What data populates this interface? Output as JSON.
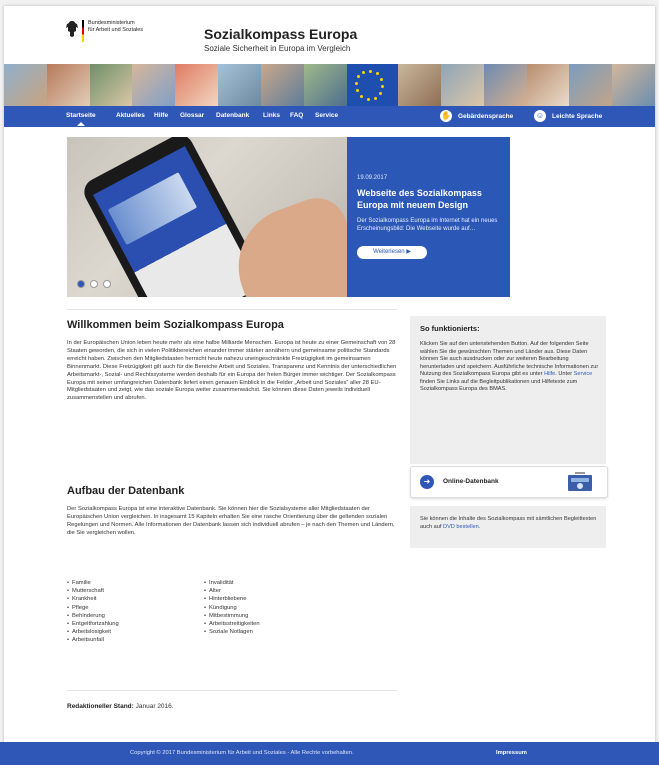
{
  "header": {
    "ministry": "Bundesministerium\nfür Arbeit und Soziales",
    "title": "Sozialkompass Europa",
    "subtitle": "Soziale Sicherheit in Europa im Vergleich"
  },
  "nav": {
    "items": [
      "Startseite",
      "Aktuelles",
      "Hilfe",
      "Glossar",
      "Datenbank",
      "Links",
      "FAQ",
      "Service"
    ],
    "active": "Startseite",
    "sign_language": "Gebärdensprache",
    "easy_language": "Leichte Sprache"
  },
  "hero": {
    "date": "19.09.2017",
    "title": "Webseite des Sozialkompass Europa mit neuem Design",
    "text": "Der Sozialkompass Europa im Internet hat ein neues Erscheinungsbild: Die Webseite wurde auf…",
    "button": "Weiterlesen"
  },
  "main": {
    "h1": "Willkommen beim Sozialkompass Europa",
    "p1": "In der Europäischen Union leben heute mehr als eine halbe Milliarde Menschen. Europa ist heute zu einer Gemeinschaft von 28 Staaten geworden, die sich in vielen Politikbereichen einander immer stärker annähern und gemeinsame politische Standards erreicht haben. Zwischen den Mitgliedstaaten herrscht heute nahezu uneingeschränkte Freizügigkeit im gemeinsamen Binnenmarkt. Diese Freizügigkeit gilt auch für die Bereiche Arbeit und Soziales. Transparenz und Kenntnis der unterschiedlichen Arbeitsmarkt-, Sozial- und Rechtssysteme werden deshalb für ein Europa der freien Bürger immer wichtiger. Der Sozialkompass Europa mit seiner umfangreichen Datenbank liefert einen genauen Einblick in die Felder „Arbeit und Soziales“ aller 28 EU-Mitgliedstaaten und zeigt, wie das soziale Europa weiter zusammenwächst. Sie können diese Daten jeweils individuell zusammenstellen und abrufen.",
    "h2": "Aufbau der Datenbank",
    "p2": "Der Sozialkompass Europa ist eine interaktive Datenbank. Sie können hier die Sozialsysteme aller Mitgliedstaaten der Europäischen Union vergleichen. In insgesamt 15 Kapiteln erhalten Sie eine rasche Orientierung über die geltenden sozialen Regelungen und Normen. Alle Informationen der Datenbank lassen sich individuell abrufen – je nach den Themen und Ländern, die Sie vergleichen wollen.",
    "list_left": [
      "Familie",
      "Mutterschaft",
      "Krankheit",
      "Pflege",
      "Behinderung",
      "Entgeltfortzahlung",
      "Arbeitslosigkeit",
      "Arbeitsunfall"
    ],
    "list_right": [
      "Invalidität",
      "Alter",
      "Hinterbliebene",
      "Kündigung",
      "Mitbestimmung",
      "Arbeitsstreitigkeiten",
      "Soziale Notlagen"
    ],
    "stand_label": "Redaktioneller Stand:",
    "stand_value": "Januar 2016."
  },
  "sidebar": {
    "heading": "So funktionierts:",
    "text_a": "Klicken Sie auf den untenstehenden Button. Auf der folgenden Seite wählen Sie die gewünschten Themen und Länder aus. Diese Daten können Sie auch ausdrucken oder zur weiteren Bearbeitung herunterladen und speichern. Ausführliche technische Informationen zur Nutzung des Sozialkompass Europa gibt es unter",
    "link_hilfe": "Hilfe",
    "text_b": ". Unter",
    "link_service": "Service",
    "text_c": "finden Sie Links auf die Begleitpublikationen und Hilfetexte zum Sozialkompass Europa des BMAS.",
    "db_button": "Online-Datenbank",
    "dvd_text": "Sie können die Inhalte des Sozialkompass mit sämtlichen Begleittexten auch auf",
    "dvd_link": "DVD bestellen."
  },
  "footer": {
    "copyright": "Copyright © 2017 Bundesministerium für Arbeit und Soziales - Alle Rechte vorbehalten.",
    "impressum": "Impressum"
  },
  "colors": {
    "brand_blue": "#2e57b8",
    "hero_blue": "#2b57b6",
    "panel_gray": "#eeeeee"
  }
}
